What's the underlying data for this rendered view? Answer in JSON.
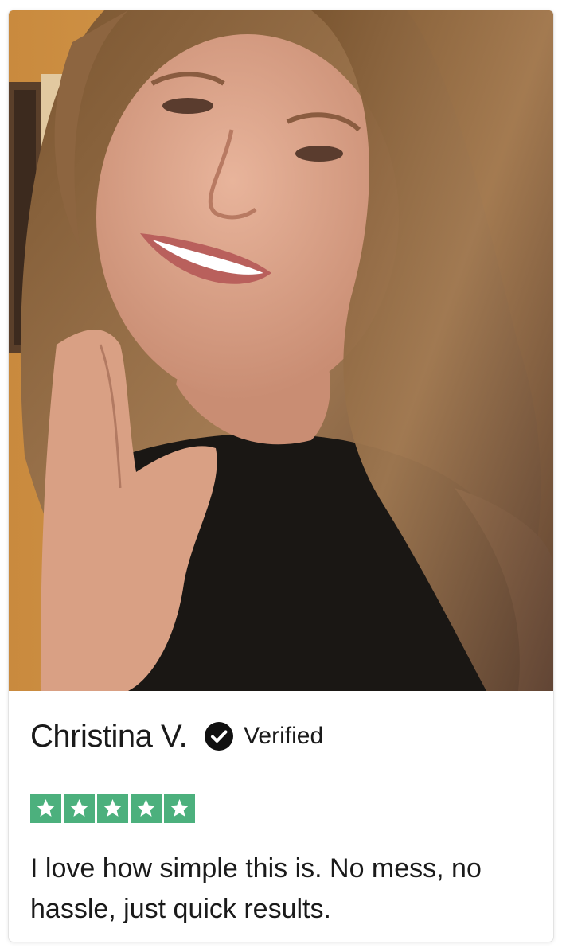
{
  "review": {
    "reviewer_name": "Christina V.",
    "verified_label": "Verified",
    "rating": 5,
    "rating_max": 5,
    "text": "I love how simple this is. No mess, no hassle, just quick results."
  },
  "colors": {
    "star_background": "#4cb07d",
    "text": "#1a1a1a",
    "verified_badge": "#111111"
  },
  "icons": {
    "verified": "check-circle-icon",
    "star": "star-icon"
  }
}
